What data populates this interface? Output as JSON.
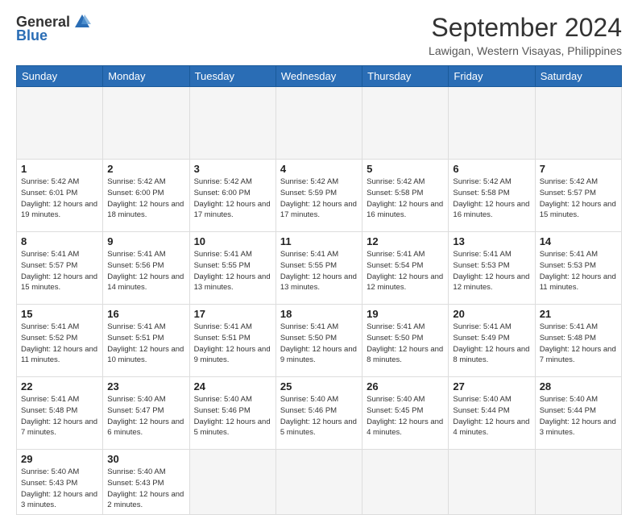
{
  "header": {
    "logo_general": "General",
    "logo_blue": "Blue",
    "title": "September 2024",
    "location": "Lawigan, Western Visayas, Philippines"
  },
  "calendar": {
    "days_of_week": [
      "Sunday",
      "Monday",
      "Tuesday",
      "Wednesday",
      "Thursday",
      "Friday",
      "Saturday"
    ],
    "weeks": [
      [
        {
          "day": "",
          "empty": true
        },
        {
          "day": "",
          "empty": true
        },
        {
          "day": "",
          "empty": true
        },
        {
          "day": "",
          "empty": true
        },
        {
          "day": "",
          "empty": true
        },
        {
          "day": "",
          "empty": true
        },
        {
          "day": "",
          "empty": true
        }
      ],
      [
        {
          "day": "1",
          "sunrise": "5:42 AM",
          "sunset": "6:01 PM",
          "daylight": "12 hours and 19 minutes."
        },
        {
          "day": "2",
          "sunrise": "5:42 AM",
          "sunset": "6:00 PM",
          "daylight": "12 hours and 18 minutes."
        },
        {
          "day": "3",
          "sunrise": "5:42 AM",
          "sunset": "6:00 PM",
          "daylight": "12 hours and 17 minutes."
        },
        {
          "day": "4",
          "sunrise": "5:42 AM",
          "sunset": "5:59 PM",
          "daylight": "12 hours and 17 minutes."
        },
        {
          "day": "5",
          "sunrise": "5:42 AM",
          "sunset": "5:58 PM",
          "daylight": "12 hours and 16 minutes."
        },
        {
          "day": "6",
          "sunrise": "5:42 AM",
          "sunset": "5:58 PM",
          "daylight": "12 hours and 16 minutes."
        },
        {
          "day": "7",
          "sunrise": "5:42 AM",
          "sunset": "5:57 PM",
          "daylight": "12 hours and 15 minutes."
        }
      ],
      [
        {
          "day": "8",
          "sunrise": "5:41 AM",
          "sunset": "5:57 PM",
          "daylight": "12 hours and 15 minutes."
        },
        {
          "day": "9",
          "sunrise": "5:41 AM",
          "sunset": "5:56 PM",
          "daylight": "12 hours and 14 minutes."
        },
        {
          "day": "10",
          "sunrise": "5:41 AM",
          "sunset": "5:55 PM",
          "daylight": "12 hours and 13 minutes."
        },
        {
          "day": "11",
          "sunrise": "5:41 AM",
          "sunset": "5:55 PM",
          "daylight": "12 hours and 13 minutes."
        },
        {
          "day": "12",
          "sunrise": "5:41 AM",
          "sunset": "5:54 PM",
          "daylight": "12 hours and 12 minutes."
        },
        {
          "day": "13",
          "sunrise": "5:41 AM",
          "sunset": "5:53 PM",
          "daylight": "12 hours and 12 minutes."
        },
        {
          "day": "14",
          "sunrise": "5:41 AM",
          "sunset": "5:53 PM",
          "daylight": "12 hours and 11 minutes."
        }
      ],
      [
        {
          "day": "15",
          "sunrise": "5:41 AM",
          "sunset": "5:52 PM",
          "daylight": "12 hours and 11 minutes."
        },
        {
          "day": "16",
          "sunrise": "5:41 AM",
          "sunset": "5:51 PM",
          "daylight": "12 hours and 10 minutes."
        },
        {
          "day": "17",
          "sunrise": "5:41 AM",
          "sunset": "5:51 PM",
          "daylight": "12 hours and 9 minutes."
        },
        {
          "day": "18",
          "sunrise": "5:41 AM",
          "sunset": "5:50 PM",
          "daylight": "12 hours and 9 minutes."
        },
        {
          "day": "19",
          "sunrise": "5:41 AM",
          "sunset": "5:50 PM",
          "daylight": "12 hours and 8 minutes."
        },
        {
          "day": "20",
          "sunrise": "5:41 AM",
          "sunset": "5:49 PM",
          "daylight": "12 hours and 8 minutes."
        },
        {
          "day": "21",
          "sunrise": "5:41 AM",
          "sunset": "5:48 PM",
          "daylight": "12 hours and 7 minutes."
        }
      ],
      [
        {
          "day": "22",
          "sunrise": "5:41 AM",
          "sunset": "5:48 PM",
          "daylight": "12 hours and 7 minutes."
        },
        {
          "day": "23",
          "sunrise": "5:40 AM",
          "sunset": "5:47 PM",
          "daylight": "12 hours and 6 minutes."
        },
        {
          "day": "24",
          "sunrise": "5:40 AM",
          "sunset": "5:46 PM",
          "daylight": "12 hours and 5 minutes."
        },
        {
          "day": "25",
          "sunrise": "5:40 AM",
          "sunset": "5:46 PM",
          "daylight": "12 hours and 5 minutes."
        },
        {
          "day": "26",
          "sunrise": "5:40 AM",
          "sunset": "5:45 PM",
          "daylight": "12 hours and 4 minutes."
        },
        {
          "day": "27",
          "sunrise": "5:40 AM",
          "sunset": "5:44 PM",
          "daylight": "12 hours and 4 minutes."
        },
        {
          "day": "28",
          "sunrise": "5:40 AM",
          "sunset": "5:44 PM",
          "daylight": "12 hours and 3 minutes."
        }
      ],
      [
        {
          "day": "29",
          "sunrise": "5:40 AM",
          "sunset": "5:43 PM",
          "daylight": "12 hours and 3 minutes."
        },
        {
          "day": "30",
          "sunrise": "5:40 AM",
          "sunset": "5:43 PM",
          "daylight": "12 hours and 2 minutes."
        },
        {
          "day": "",
          "empty": true
        },
        {
          "day": "",
          "empty": true
        },
        {
          "day": "",
          "empty": true
        },
        {
          "day": "",
          "empty": true
        },
        {
          "day": "",
          "empty": true
        }
      ]
    ],
    "labels": {
      "sunrise": "Sunrise:",
      "sunset": "Sunset:",
      "daylight": "Daylight:"
    }
  }
}
